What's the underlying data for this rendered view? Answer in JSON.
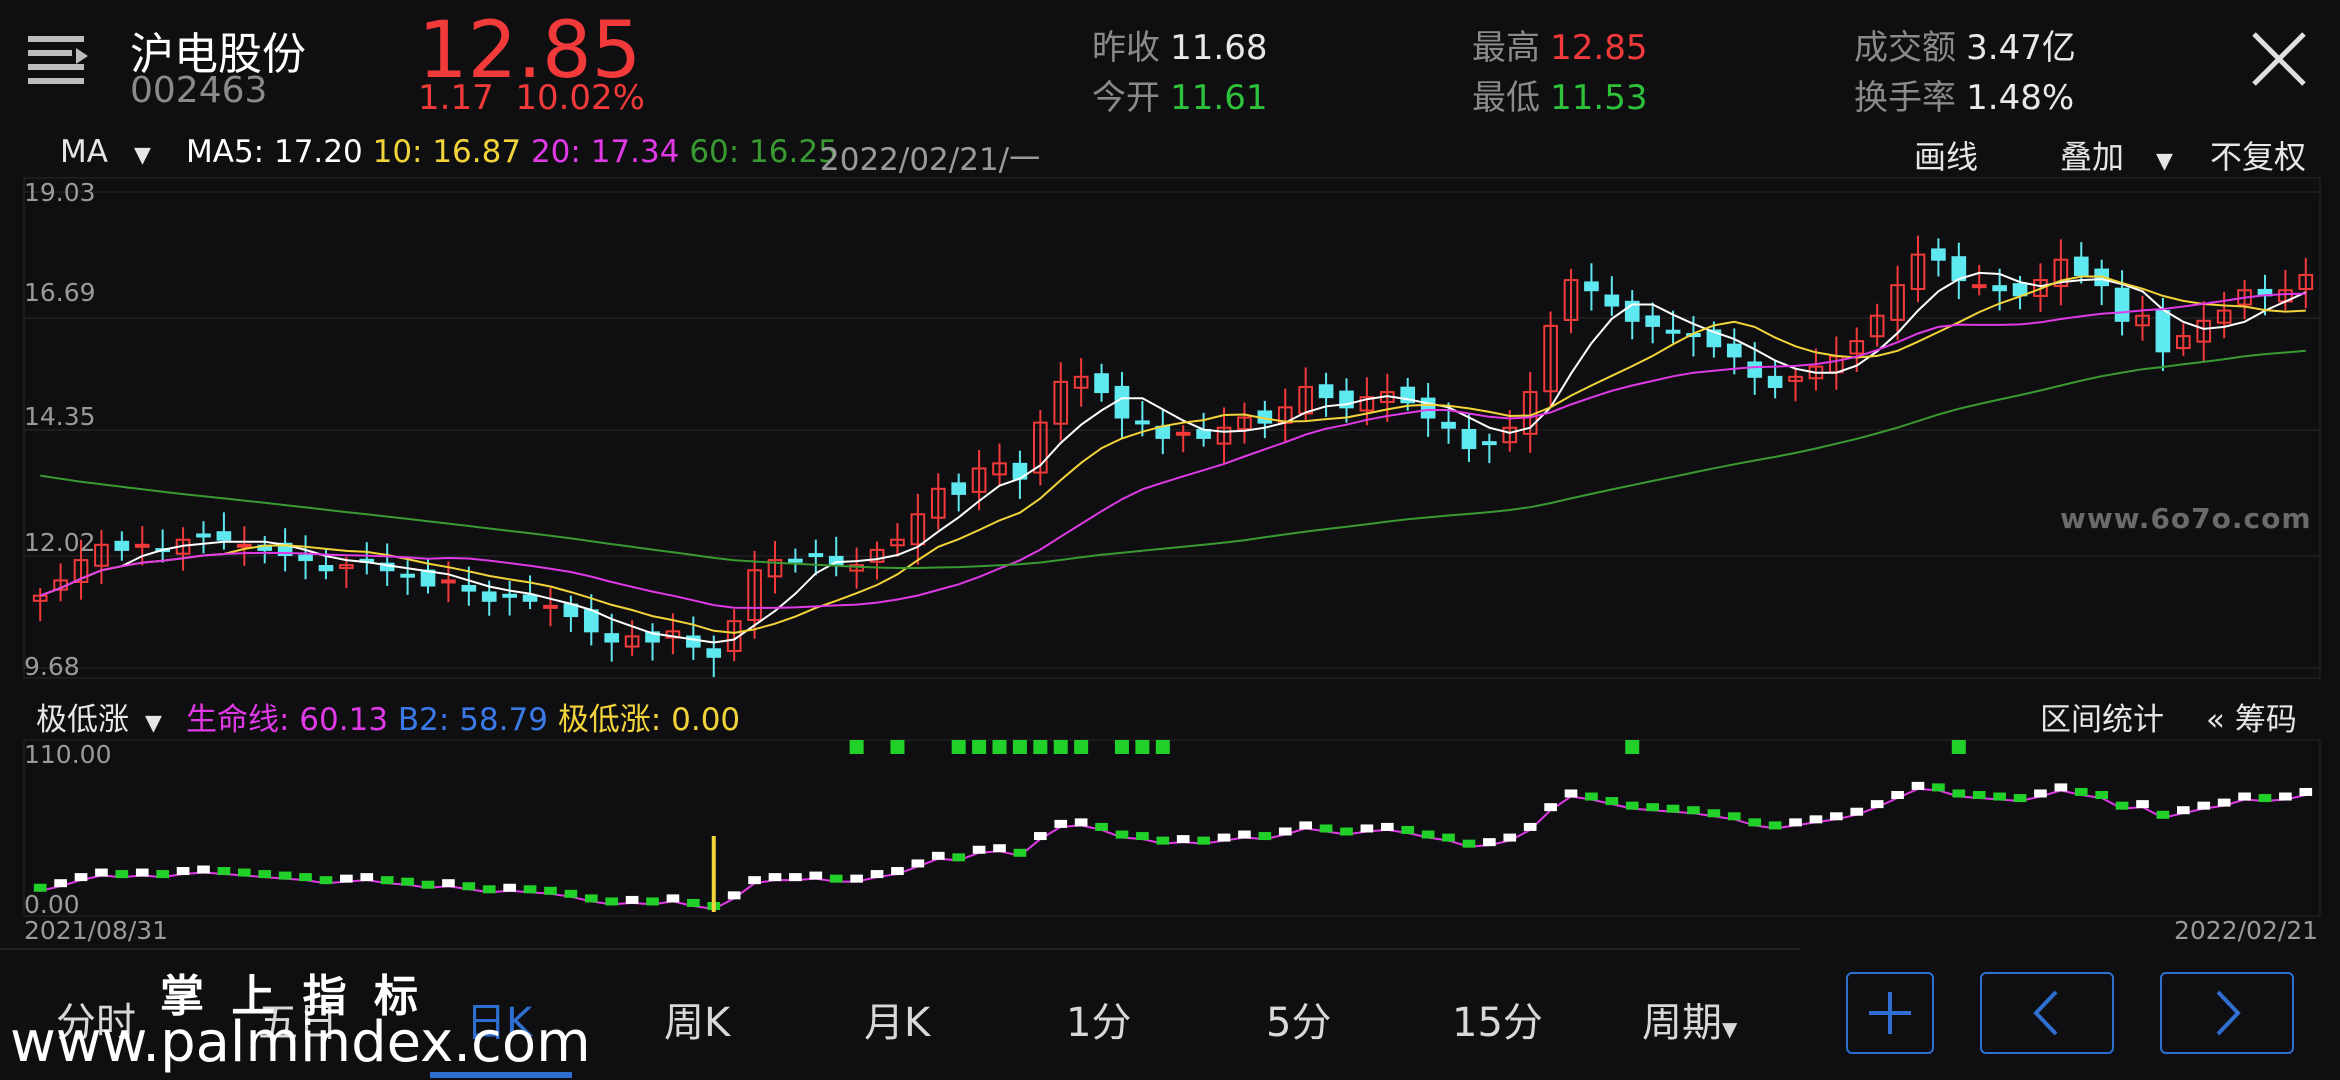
{
  "header": {
    "stock_name": "沪电股份",
    "stock_code": "002463",
    "price": "12.85",
    "change": "1.17",
    "change_pct": "10.02%",
    "stats": [
      {
        "label": "昨收",
        "value": "11.68",
        "color": "#e8e8e8"
      },
      {
        "label": "今开",
        "value": "11.61",
        "color": "#2ec23a"
      },
      {
        "label": "最高",
        "value": "12.85",
        "color": "#f23a3a"
      },
      {
        "label": "最低",
        "value": "11.53",
        "color": "#2ec23a"
      },
      {
        "label": "成交额",
        "value": "3.47亿",
        "color": "#e8e8e8"
      },
      {
        "label": "换手率",
        "value": "1.48%",
        "color": "#e8e8e8"
      }
    ]
  },
  "ma_bar": {
    "selector": "MA",
    "ma5": "MA5: 17.20",
    "ma10": "10: 16.87",
    "ma20": "20: 17.34",
    "ma60": "60: 16.25",
    "date": "2022/02/21/一",
    "draw": "画线",
    "overlay": "叠加",
    "adjust": "不复权"
  },
  "indicator_bar": {
    "selector": "极低涨",
    "life_line": "生命线: 60.13",
    "b2": "B2: 58.79",
    "low_rise": "极低涨: 0.00",
    "range_stats": "区间统计",
    "chips": "« 筹码"
  },
  "axes": {
    "price_ticks": [
      "19.03",
      "16.69",
      "14.35",
      "12.02",
      "9.68"
    ],
    "ind_ticks": [
      "110.00",
      "0.00"
    ],
    "date_start": "2021/08/31",
    "date_end": "2022/02/21"
  },
  "bottom_tabs": [
    "分时",
    "五日",
    "日K",
    "周K",
    "月K",
    "1分",
    "5分",
    "15分",
    "周期"
  ],
  "active_tab": "日K",
  "watermarks": {
    "chart": "www.6o7o.com",
    "brand_cn": "掌 上 指 标",
    "brand_url": "www.palmindex.com"
  },
  "colors": {
    "up": "#f23a3a",
    "down": "#5ee8f0",
    "ma5": "#ffffff",
    "ma10": "#f2d43a",
    "ma20": "#e03ae6",
    "ma60": "#3a9a32",
    "accent": "#2f6fd0"
  },
  "chart_data": {
    "type": "candlestick",
    "ylim": [
      9.68,
      19.03
    ],
    "x_start": "2021/08/31",
    "x_end": "2022/02/21",
    "closes": [
      11.1,
      11.4,
      11.8,
      12.1,
      12.0,
      12.1,
      12.0,
      12.2,
      12.3,
      12.2,
      12.1,
      12.0,
      11.9,
      11.8,
      11.6,
      11.7,
      11.8,
      11.6,
      11.5,
      11.3,
      11.4,
      11.2,
      11.0,
      11.1,
      11.0,
      10.9,
      10.7,
      10.4,
      10.2,
      10.3,
      10.2,
      10.4,
      10.1,
      9.9,
      10.6,
      11.6,
      11.8,
      11.8,
      11.9,
      11.7,
      11.7,
      12.0,
      12.2,
      12.7,
      13.2,
      13.1,
      13.6,
      13.7,
      13.4,
      14.5,
      15.3,
      15.4,
      15.1,
      14.6,
      14.5,
      14.2,
      14.3,
      14.2,
      14.4,
      14.6,
      14.5,
      14.8,
      15.2,
      15.0,
      14.8,
      15.0,
      15.1,
      14.9,
      14.6,
      14.4,
      14.0,
      14.1,
      14.4,
      15.1,
      16.4,
      17.3,
      17.1,
      16.8,
      16.5,
      16.4,
      16.3,
      16.2,
      16.0,
      15.8,
      15.4,
      15.2,
      15.4,
      15.6,
      15.8,
      16.1,
      16.6,
      17.2,
      17.8,
      17.7,
      17.3,
      17.2,
      17.1,
      17.0,
      17.3,
      17.7,
      17.4,
      17.2,
      16.5,
      16.6,
      15.9,
      16.2,
      16.5,
      16.7,
      17.1,
      17.0,
      17.1,
      17.4
    ],
    "signal_days": [
      40,
      42,
      45,
      46,
      47,
      48,
      49,
      50,
      51,
      53,
      54,
      55,
      78,
      94
    ]
  }
}
